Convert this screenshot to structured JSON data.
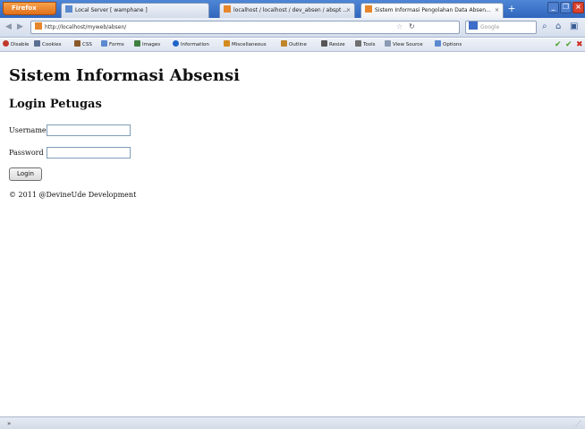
{
  "browser": {
    "app_button": "Firefox",
    "tabs": [
      {
        "label": "Local Server [ wamphane ]",
        "favicon_color": "#5b8ad0"
      },
      {
        "label": "localhost / localhost / dev_absen / abspt ...",
        "favicon_color": "#e7862a"
      },
      {
        "label": "Sistem Informasi Pengolahan Data Absen...",
        "favicon_color": "#e7862a",
        "active": true
      }
    ],
    "tab_close": "×",
    "new_tab": "+",
    "window_buttons": [
      "_",
      "❐",
      "×"
    ],
    "url": "http://localhost/myweb/absen/",
    "search_placeholder": "Google",
    "toolbar_items": [
      {
        "label": "Disable",
        "icon_color": "#c0392b"
      },
      {
        "label": "Cookies",
        "icon_color": "#5a6f91"
      },
      {
        "label": "CSS",
        "icon_color": "#8a5a2b"
      },
      {
        "label": "Forms",
        "icon_color": "#5b8ad0"
      },
      {
        "label": "Images",
        "icon_color": "#3f7f3f"
      },
      {
        "label": "Information",
        "icon_color": "#1e64c8"
      },
      {
        "label": "Miscellaneous",
        "icon_color": "#d48b1e"
      },
      {
        "label": "Outline",
        "icon_color": "#c0852b"
      },
      {
        "label": "Resize",
        "icon_color": "#555555"
      },
      {
        "label": "Tools",
        "icon_color": "#6f6f6f"
      },
      {
        "label": "View Source",
        "icon_color": "#8a9bb3"
      },
      {
        "label": "Options",
        "icon_color": "#5b8ad0"
      }
    ]
  },
  "page": {
    "title": "Sistem Informasi Absensi",
    "section_title": "Login Petugas",
    "username_label": "Username",
    "username_value": "",
    "password_label": "Password",
    "password_value": "",
    "login_button": "Login",
    "footer": "© 2011 @DevineUde Development"
  },
  "statusbar": {
    "left": "»"
  },
  "colors": {
    "tabbar": "#3a72c8",
    "firefox_button": "#e98a2f",
    "input_border": "#7f9db9"
  }
}
